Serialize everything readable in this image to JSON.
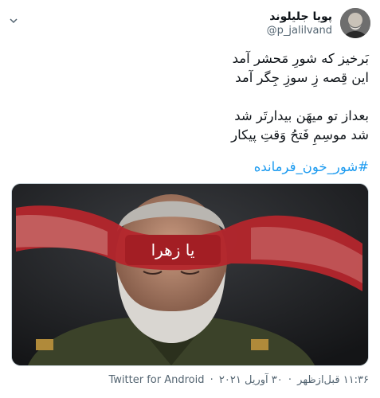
{
  "author": {
    "name": "پویا جلیلوند",
    "handle": "@p_jalilvand"
  },
  "tweet": {
    "lines_stanza1": [
      "بَرخیز که شورِ مَحشر آمد",
      "این قِصه زِ سوزِ جِگر آمد"
    ],
    "lines_stanza2": [
      "بعداز تو میهَن بیدارتَر شد",
      "شد موسِمِ فَتحُ وَقتِ پیکار"
    ],
    "hashtag": "#شور_خون_فرمانده"
  },
  "media": {
    "headband_text": "یا زهرا"
  },
  "meta": {
    "time": "۱۱:۳۶ قبل‌ازظهر",
    "date": "۳۰ آوریل ۲۰۲۱",
    "dot": "·",
    "source": "Twitter for Android"
  },
  "icons": {
    "more": "chevron-down-icon"
  }
}
